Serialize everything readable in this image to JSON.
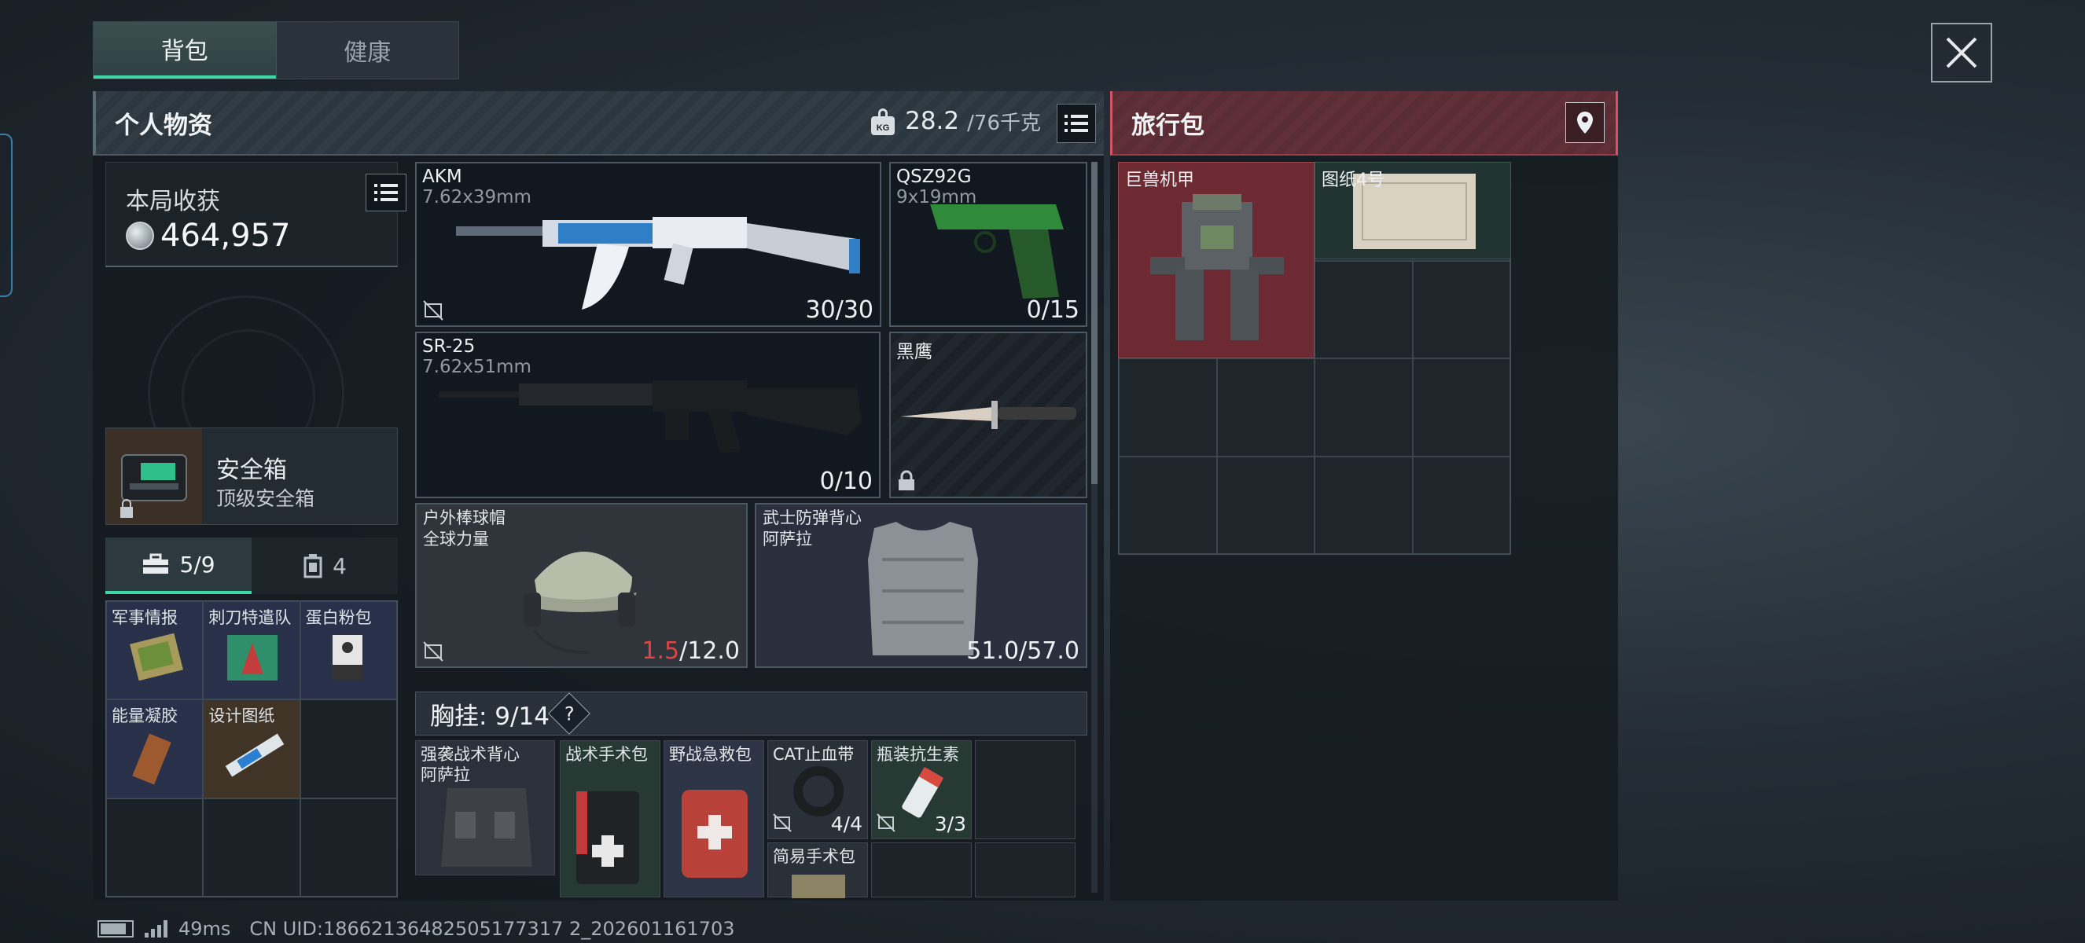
{
  "tabs": [
    {
      "label": "背包",
      "active": true
    },
    {
      "label": "健康",
      "active": false
    }
  ],
  "personal": {
    "title": "个人物资",
    "weight_current": "28.2",
    "weight_max": "/76千克",
    "harvest_label": "本局收获",
    "harvest_value": "464,957",
    "safe_box": {
      "name": "安全箱",
      "sub": "顶级安全箱"
    },
    "pouch_tabs": [
      {
        "icon": "toolbox-icon",
        "label": "5/9",
        "active": true
      },
      {
        "icon": "canister-icon",
        "label": "4",
        "active": false
      }
    ],
    "pouch_items": [
      "军事情报",
      "刺刀特遣队",
      "蛋白粉包",
      "能量凝胶",
      "设计图纸"
    ]
  },
  "weapons": {
    "akm": {
      "name": "AKM",
      "ammo": "7.62x39mm",
      "count": "30/30"
    },
    "qsz": {
      "name": "QSZ92G",
      "ammo": "9x19mm",
      "count": "0/15"
    },
    "sr25": {
      "name": "SR-25",
      "ammo": "7.62x51mm",
      "count": "0/10"
    },
    "knife": {
      "name": "黑鹰"
    }
  },
  "gear": {
    "helmet": {
      "name": "户外棒球帽",
      "sub": "全球力量",
      "dur_current": "1.5",
      "dur_max": "/12.0"
    },
    "vest": {
      "name": "武士防弹背心",
      "sub": "阿萨拉",
      "durability": "51.0/57.0"
    }
  },
  "chest": {
    "label": "胸挂: 9/14",
    "help": "?",
    "items": {
      "vest": {
        "name": "强袭战术背心",
        "sub": "阿萨拉"
      },
      "kit": {
        "name": "战术手术包"
      },
      "aid": {
        "name": "野战急救包"
      },
      "cat": {
        "name": "CAT止血带",
        "count": "4/4"
      },
      "surgery": {
        "name": "简易手术包"
      },
      "antibiotic": {
        "name": "瓶装抗生素",
        "count": "3/3"
      }
    }
  },
  "backpack": {
    "title": "旅行包",
    "items": [
      "巨兽机甲",
      "图纸4号"
    ]
  },
  "status": {
    "ping": "49ms",
    "uid": "CN UID:18662136482505177317 2_202601161703"
  },
  "colors": {
    "accent": "#3fd7a5",
    "backpack": "#d45364",
    "durability_low": "#e04545"
  }
}
